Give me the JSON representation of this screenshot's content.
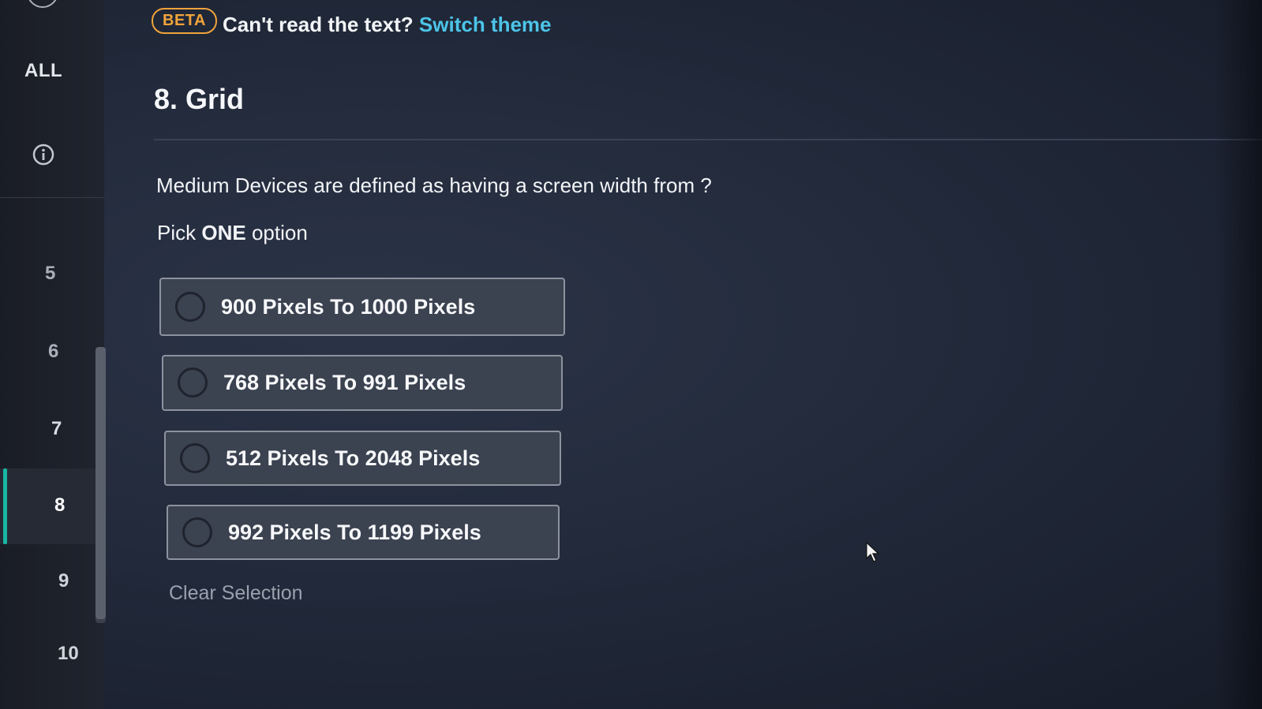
{
  "sidebar": {
    "all_label": "ALL",
    "info_icon": "info-icon",
    "items": [
      {
        "label": "5"
      },
      {
        "label": "6"
      },
      {
        "label": "7"
      },
      {
        "label": "8"
      },
      {
        "label": "9"
      },
      {
        "label": "10"
      }
    ],
    "active_item": "8",
    "accent_color": "#19b7a3"
  },
  "banner": {
    "beta_label": "BETA",
    "notice_text": "Can't read the text?",
    "switch_link": "Switch theme",
    "beta_color": "#f0a43a",
    "link_color": "#4cc4e8"
  },
  "question": {
    "title": "8. Grid",
    "text": "Medium Devices are defined as having a screen width from ?",
    "pick_prefix": "Pick",
    "pick_emphasis": "ONE",
    "pick_suffix": "option",
    "options": [
      {
        "label": "900 Pixels To 1000 Pixels"
      },
      {
        "label": "768 Pixels To 991 Pixels"
      },
      {
        "label": "512 Pixels To 2048 Pixels"
      },
      {
        "label": "992 Pixels To 1199 Pixels"
      }
    ],
    "clear_label": "Clear Selection"
  }
}
